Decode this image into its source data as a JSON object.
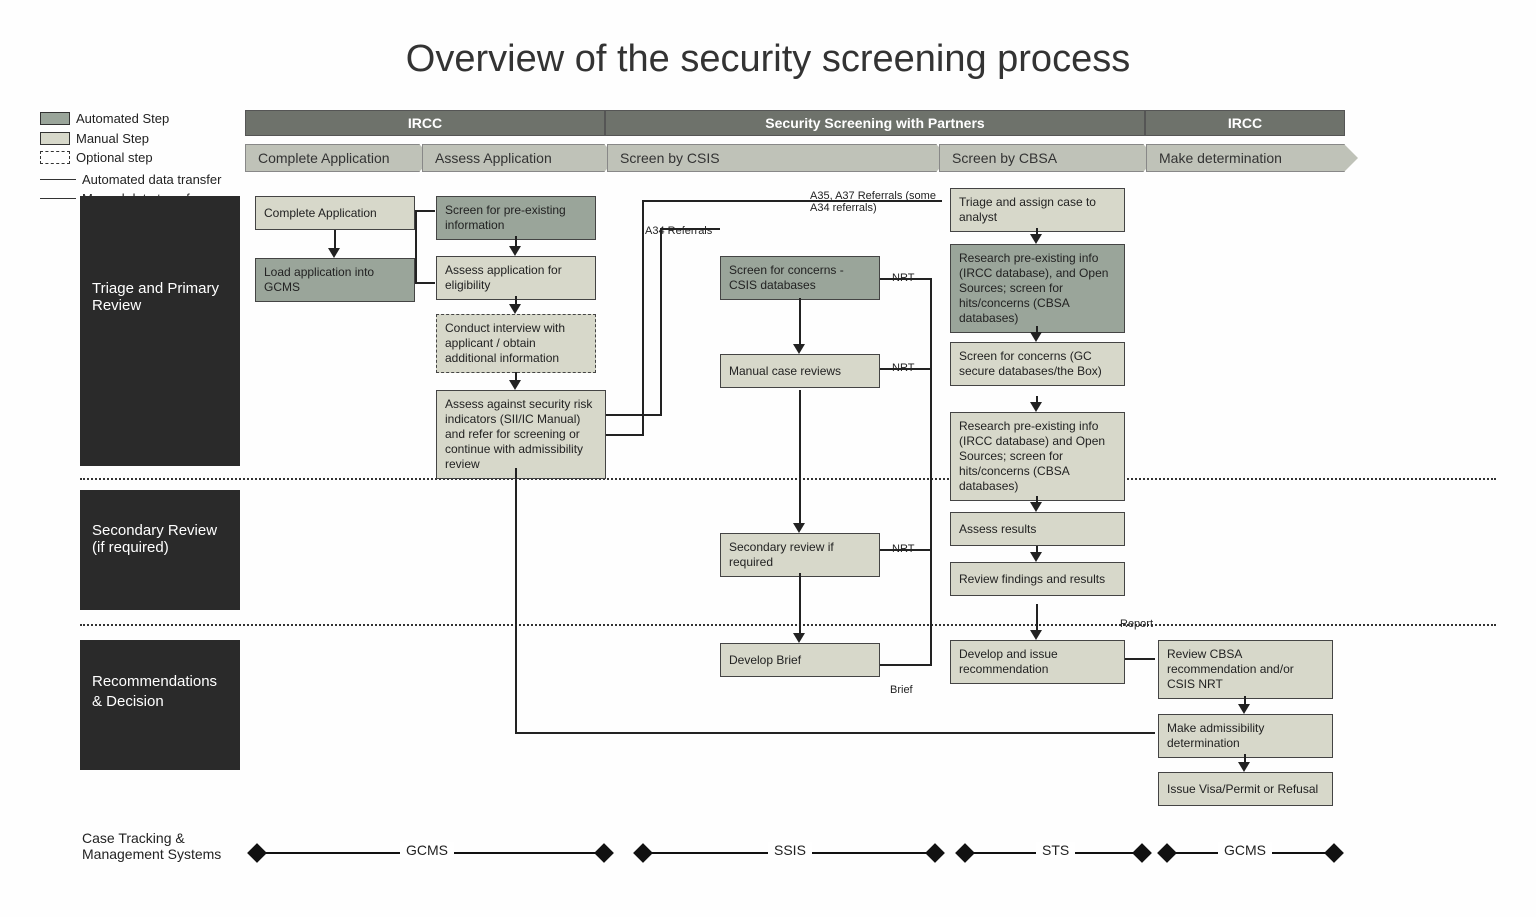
{
  "title": "Overview of the security screening process",
  "legend": {
    "automated": "Automated Step",
    "manual": "Manual Step",
    "optional": "Optional step",
    "auto_transfer": "Automated data transfer",
    "manual_transfer": "Manual data transfer"
  },
  "headers": {
    "ircc1": "IRCC",
    "partners": "Security Screening with Partners",
    "ircc2": "IRCC"
  },
  "phases": {
    "complete": "Complete Application",
    "assess": "Assess Application",
    "csis": "Screen by CSIS",
    "cbsa": "Screen by CBSA",
    "determine": "Make determination"
  },
  "rows": {
    "triage": "Triage and Primary Review",
    "secondary": "Secondary Review (if required)",
    "recom": "Recommendations & Decision"
  },
  "boxes": {
    "complete_app": "Complete Application",
    "load_gcms": "Load application into GCMS",
    "screen_pre": "Screen for pre-existing information",
    "assess_elig": "Assess application for eligibility",
    "conduct_interview": "Conduct interview with applicant / obtain additional information",
    "assess_indicators": "Assess against security risk indicators (SII/IC Manual) and refer for screening or continue with admissibility review",
    "screen_csis": "Screen for concerns - CSIS databases",
    "manual_case": "Manual case reviews",
    "secondary_review": "Secondary review if required",
    "develop_brief": "Develop Brief",
    "triage_assign": "Triage and assign case to analyst",
    "research_pre1": "Research pre-existing info (IRCC database), and Open Sources; screen for hits/concerns (CBSA databases)",
    "screen_gc": "Screen for concerns (GC secure databases/the Box)",
    "research_pre2": "Research pre-existing info (IRCC database) and Open Sources; screen for hits/concerns (CBSA databases)",
    "assess_results": "Assess results",
    "review_findings": "Review findings and results",
    "develop_rec": "Develop and issue recommendation",
    "review_cbsa": "Review CBSA recommendation and/or CSIS NRT",
    "make_admis": "Make admissibility determination",
    "issue_visa": "Issue Visa/Permit or Refusal"
  },
  "annotations": {
    "a35": "A35, A37 Referrals (some A34 referrals)",
    "a34": "A34 Referrals",
    "nrt1": "NRT",
    "nrt2": "NRT",
    "nrt3": "NRT",
    "brief": "Brief",
    "report": "Report"
  },
  "systems": {
    "label": "Case Tracking & Management Systems",
    "gcms1": "GCMS",
    "ssis": "SSIS",
    "sts": "STS",
    "gcms2": "GCMS"
  }
}
